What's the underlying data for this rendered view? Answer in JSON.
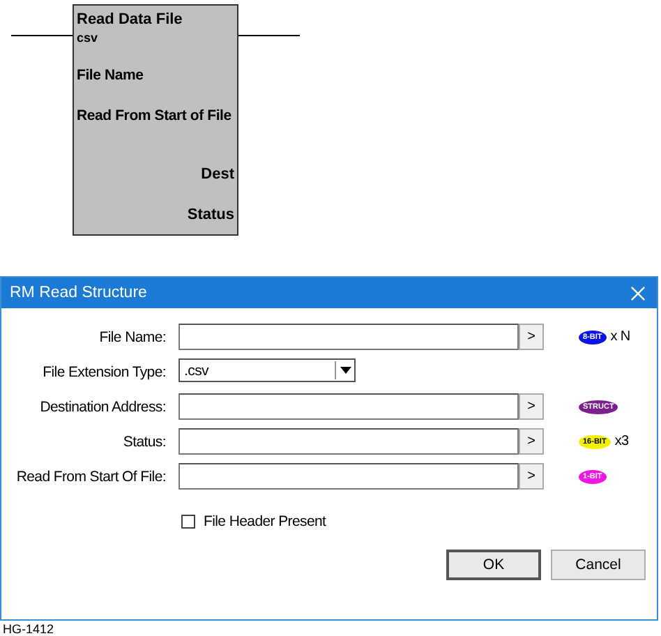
{
  "block": {
    "title": "Read Data File",
    "subtitle": "csv",
    "inputs": [
      "File Name",
      "Read From Start of File"
    ],
    "outputs": [
      "Dest",
      "Status"
    ]
  },
  "dialog": {
    "title": "RM Read Structure",
    "fields": [
      {
        "kind": "text",
        "label": "File Name:",
        "browse": ">",
        "tag": {
          "text": "8-BIT",
          "color": "#0a14e6"
        },
        "count": "x N"
      },
      {
        "kind": "dropdown",
        "label": "File Extension Type:",
        "value": ".csv"
      },
      {
        "kind": "text",
        "label": "Destination Address:",
        "browse": ">",
        "tag": {
          "text": "STRUCT",
          "color": "#7a1f8c"
        }
      },
      {
        "kind": "text",
        "label": "Status:",
        "browse": ">",
        "tag": {
          "text": "16-BIT",
          "color": "#f5f000"
        },
        "count": "x3"
      },
      {
        "kind": "text",
        "label": "Read From Start Of File:",
        "browse": ">",
        "tag": {
          "text": "1-BIT",
          "color": "#f014e6"
        }
      }
    ],
    "checkbox": {
      "label": "File Header Present",
      "checked": false
    },
    "buttons": [
      "OK",
      "Cancel"
    ]
  },
  "caption": "HG-1412"
}
